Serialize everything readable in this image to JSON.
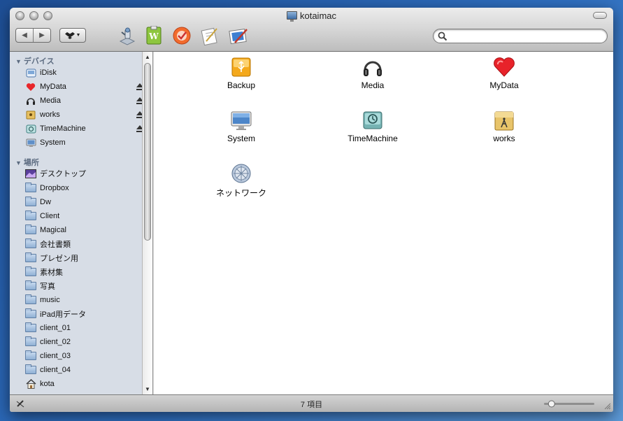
{
  "window": {
    "title": "kotaimac"
  },
  "toolbar": {
    "back_icon": "back-arrow-icon",
    "forward_icon": "forward-arrow-icon",
    "action_icon": "dropbox-icon",
    "apps": [
      "automator-icon",
      "text-wrangler-icon",
      "todo-icon",
      "textedit-icon",
      "preview-icon"
    ]
  },
  "search": {
    "value": "",
    "placeholder": ""
  },
  "sidebar": {
    "devices_header": "デバイス",
    "devices": [
      {
        "label": "iDisk",
        "icon": "idisk-icon",
        "eject": false
      },
      {
        "label": "MyData",
        "icon": "heart-drive-icon",
        "eject": true
      },
      {
        "label": "Media",
        "icon": "headphones-icon",
        "eject": true
      },
      {
        "label": "works",
        "icon": "works-drive-icon",
        "eject": true
      },
      {
        "label": "TimeMachine",
        "icon": "timemachine-icon",
        "eject": true
      },
      {
        "label": "System",
        "icon": "imac-icon",
        "eject": false
      }
    ],
    "places_header": "場所",
    "places": [
      {
        "label": "デスクトップ",
        "icon": "desktop-icon"
      },
      {
        "label": "Dropbox",
        "icon": "folder-icon"
      },
      {
        "label": "Dw",
        "icon": "folder-icon"
      },
      {
        "label": "Client",
        "icon": "folder-icon"
      },
      {
        "label": "Magical",
        "icon": "folder-icon"
      },
      {
        "label": "会社書類",
        "icon": "folder-icon"
      },
      {
        "label": "プレゼン用",
        "icon": "folder-icon"
      },
      {
        "label": "素材集",
        "icon": "folder-icon"
      },
      {
        "label": "写真",
        "icon": "folder-icon"
      },
      {
        "label": "music",
        "icon": "folder-icon"
      },
      {
        "label": "iPad用データ",
        "icon": "folder-icon"
      },
      {
        "label": "client_01",
        "icon": "folder-icon"
      },
      {
        "label": "client_02",
        "icon": "folder-icon"
      },
      {
        "label": "client_03",
        "icon": "folder-icon"
      },
      {
        "label": "client_04",
        "icon": "folder-icon"
      },
      {
        "label": "kota",
        "icon": "home-icon"
      }
    ]
  },
  "content": {
    "items": [
      {
        "label": "Backup",
        "icon": "usb-drive-icon"
      },
      {
        "label": "Media",
        "icon": "headphones-icon"
      },
      {
        "label": "MyData",
        "icon": "heart-drive-icon"
      },
      {
        "label": "System",
        "icon": "imac-icon"
      },
      {
        "label": "TimeMachine",
        "icon": "timemachine-icon"
      },
      {
        "label": "works",
        "icon": "works-drive-icon"
      },
      {
        "label": "ネットワーク",
        "icon": "network-globe-icon"
      }
    ]
  },
  "status": {
    "text": "7 項目",
    "icon_size_fraction": 0.15
  },
  "colors": {
    "sidebar_bg": "#d7dde6",
    "sidebar_header": "#5c6b80",
    "desktop": "#2f6fc0"
  }
}
